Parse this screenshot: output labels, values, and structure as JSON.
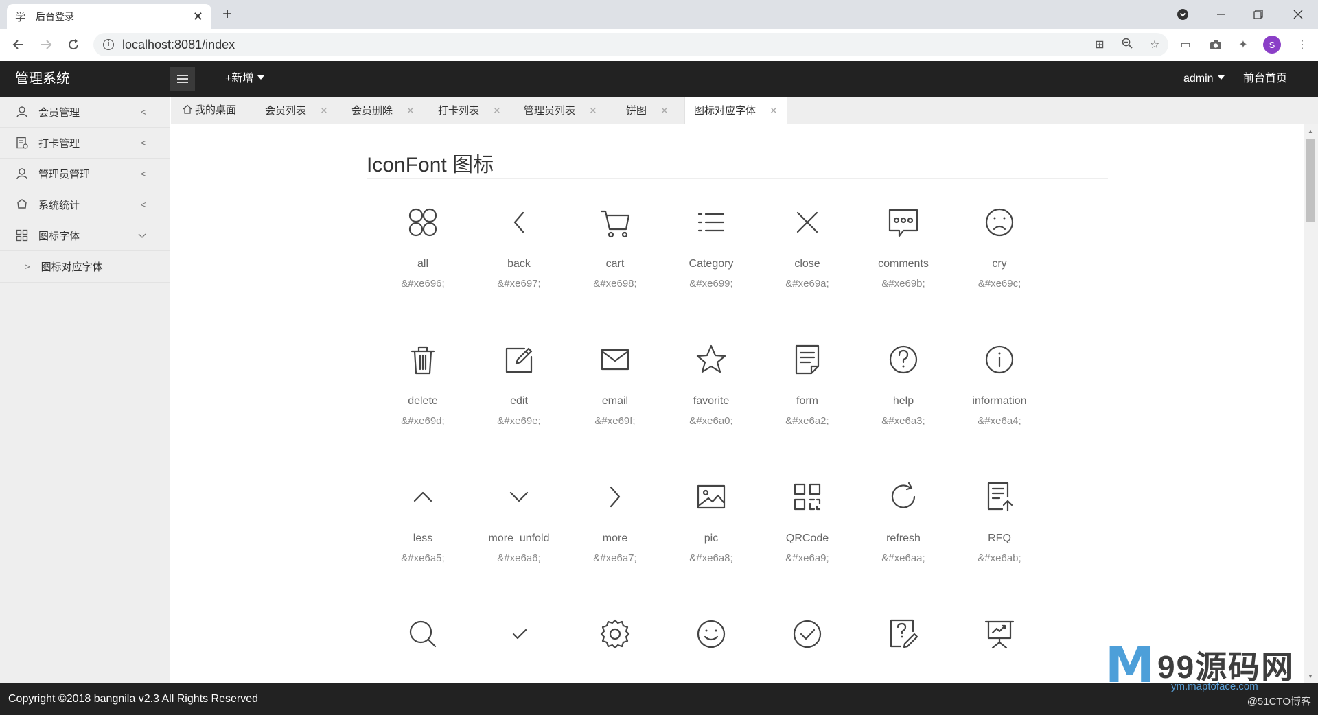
{
  "browser": {
    "tab_title": "后台登录",
    "tab_favicon": "学",
    "url": "localhost:8081/index",
    "profile_initial": "S"
  },
  "header": {
    "logo": "管理系统",
    "add_label": "+新增",
    "user": "admin",
    "front_link": "前台首页"
  },
  "sidebar": {
    "items": [
      {
        "label": "会员管理",
        "icon": "user-icon"
      },
      {
        "label": "打卡管理",
        "icon": "clipboard-icon"
      },
      {
        "label": "管理员管理",
        "icon": "admin-icon"
      },
      {
        "label": "系统统计",
        "icon": "chart-icon"
      },
      {
        "label": "图标字体",
        "icon": "grid-icon"
      }
    ],
    "subitem": "图标对应字体"
  },
  "tabs": [
    {
      "label": "我的桌面"
    },
    {
      "label": "会员列表"
    },
    {
      "label": "会员删除"
    },
    {
      "label": "打卡列表"
    },
    {
      "label": "管理员列表"
    },
    {
      "label": "饼图"
    },
    {
      "label": "图标对应字体"
    }
  ],
  "content": {
    "title": "IconFont 图标",
    "icons": [
      {
        "name": "all",
        "code": "&#xe696;"
      },
      {
        "name": "back",
        "code": "&#xe697;"
      },
      {
        "name": "cart",
        "code": "&#xe698;"
      },
      {
        "name": "Category",
        "code": "&#xe699;"
      },
      {
        "name": "close",
        "code": "&#xe69a;"
      },
      {
        "name": "comments",
        "code": "&#xe69b;"
      },
      {
        "name": "cry",
        "code": "&#xe69c;"
      },
      {
        "name": "delete",
        "code": "&#xe69d;"
      },
      {
        "name": "edit",
        "code": "&#xe69e;"
      },
      {
        "name": "email",
        "code": "&#xe69f;"
      },
      {
        "name": "favorite",
        "code": "&#xe6a0;"
      },
      {
        "name": "form",
        "code": "&#xe6a2;"
      },
      {
        "name": "help",
        "code": "&#xe6a3;"
      },
      {
        "name": "information",
        "code": "&#xe6a4;"
      },
      {
        "name": "less",
        "code": "&#xe6a5;"
      },
      {
        "name": "more_unfold",
        "code": "&#xe6a6;"
      },
      {
        "name": "more",
        "code": "&#xe6a7;"
      },
      {
        "name": "pic",
        "code": "&#xe6a8;"
      },
      {
        "name": "QRCode",
        "code": "&#xe6a9;"
      },
      {
        "name": "refresh",
        "code": "&#xe6aa;"
      },
      {
        "name": "RFQ",
        "code": "&#xe6ab;"
      },
      {
        "name": "",
        "code": ""
      },
      {
        "name": "",
        "code": ""
      },
      {
        "name": "",
        "code": ""
      },
      {
        "name": "",
        "code": ""
      },
      {
        "name": "",
        "code": ""
      },
      {
        "name": "",
        "code": ""
      },
      {
        "name": "",
        "code": ""
      }
    ]
  },
  "footer": {
    "copyright": "Copyright ©2018 bangnila v2.3 All Rights Reserved"
  },
  "watermark": {
    "brand": "99源码网",
    "url": "ym.maptoface.com",
    "credit": "@51CTO博客"
  }
}
